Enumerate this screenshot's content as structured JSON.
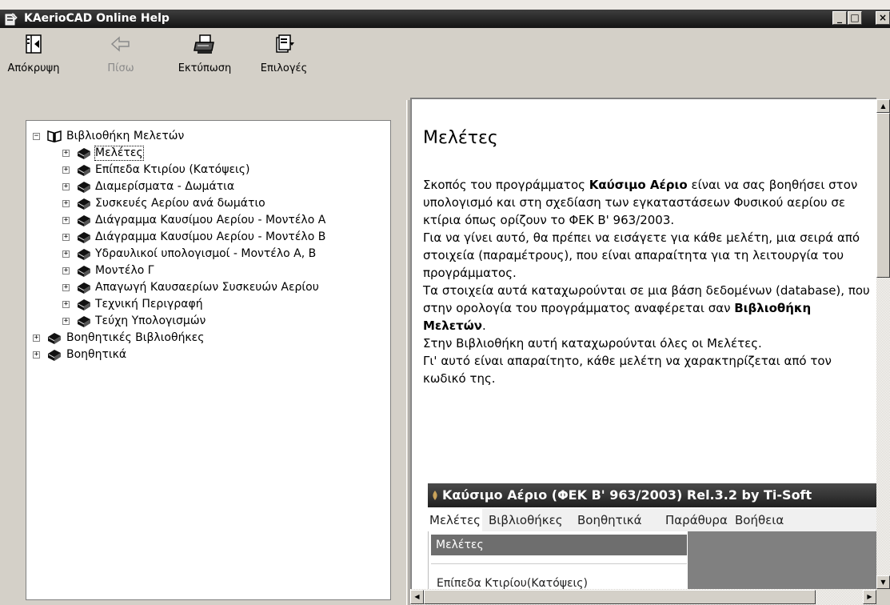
{
  "window": {
    "title": "KAerioCAD Online Help",
    "controls": {
      "minimize": "_",
      "maximize": "□",
      "close": "×"
    }
  },
  "toolbar": {
    "items": [
      {
        "label": "Απόκρυψη",
        "icon": "hide-icon",
        "enabled": true
      },
      {
        "label": "Πίσω",
        "icon": "back-arrow-icon",
        "enabled": false
      },
      {
        "label": "Εκτύπωση",
        "icon": "printer-icon",
        "enabled": true
      },
      {
        "label": "Επιλογές",
        "icon": "options-icon",
        "enabled": true
      }
    ]
  },
  "tree": {
    "root": {
      "label": "Βιβλιοθήκη Μελετών",
      "expanded": true,
      "icon": "open-book-icon"
    },
    "children": [
      {
        "label": "Μελέτες",
        "selected": true
      },
      {
        "label": "Επίπεδα Κτιρίου (Κατόψεις)"
      },
      {
        "label": "Διαμερίσματα - Δωμάτια"
      },
      {
        "label": "Συσκευές Αερίου ανά δωμάτιο"
      },
      {
        "label": "Διάγραμμα Καυσίμου Αερίου - Μοντέλο Α"
      },
      {
        "label": "Διάγραμμα Καυσίμου Αερίου - Μοντέλο Β"
      },
      {
        "label": "Υδραυλικοί υπολογισμοί - Μοντέλο Α, Β"
      },
      {
        "label": "Μοντέλο Γ"
      },
      {
        "label": "Απαγωγή Καυσαερίων Συσκευών Αερίου"
      },
      {
        "label": "Τεχνική Περιγραφή"
      },
      {
        "label": "Τεύχη Υπολογισμών"
      }
    ],
    "siblings": [
      {
        "label": "Βοηθητικές Βιβλιοθήκες"
      },
      {
        "label": "Βοηθητικά"
      }
    ]
  },
  "topic": {
    "title": "Μελέτες",
    "p1_pre": "Σκοπός του προγράμματος ",
    "p1_bold": "Καύσιμο Αέριο",
    "p1_post": " είναι να σας βοηθήσει στον υπολογισμό και στη σχεδίαση των εγκαταστάσεων Φυσικού αερίου σε κτίρια όπως ορίζουν το ΦΕΚ Β' 963/2003.",
    "p2": "Για να γίνει αυτό, θα πρέπει να εισάγετε για κάθε μελέτη, μια σειρά από στοιχεία (παραμέτρους), που είναι απαραίτητα για τη λειτουργία του προγράμματος.",
    "p3_pre": "Τα στοιχεία αυτά καταχωρούνται σε μια βάση δεδομένων (database), που στην ορολογία του προγράμματος αναφέρεται σαν ",
    "p3_bold": "Βιβλιοθήκη Μελετών",
    "p3_post": ".",
    "p4": "Στην Βιβλιοθήκη αυτή καταχωρούνται όλες οι Μελέτες.",
    "p5": "Γι' αυτό είναι απαραίτητο, κάθε μελέτη να χαρακτηρίζεται από τον κωδικό της."
  },
  "embedded_screenshot": {
    "title": "Καύσιμο Αέριο (ΦΕΚ Β' 963/2003) Rel.3.2 by Ti-Soft",
    "menu": [
      "Μελέτες",
      "Βιβλιοθήκες",
      "Βοηθητικά",
      "Παράθυρα",
      "Βοήθεια"
    ],
    "dropdown_selected": "Μελέτες",
    "dropdown_next": "Επίπεδα Κτιρίου(Κατόψεις)"
  }
}
